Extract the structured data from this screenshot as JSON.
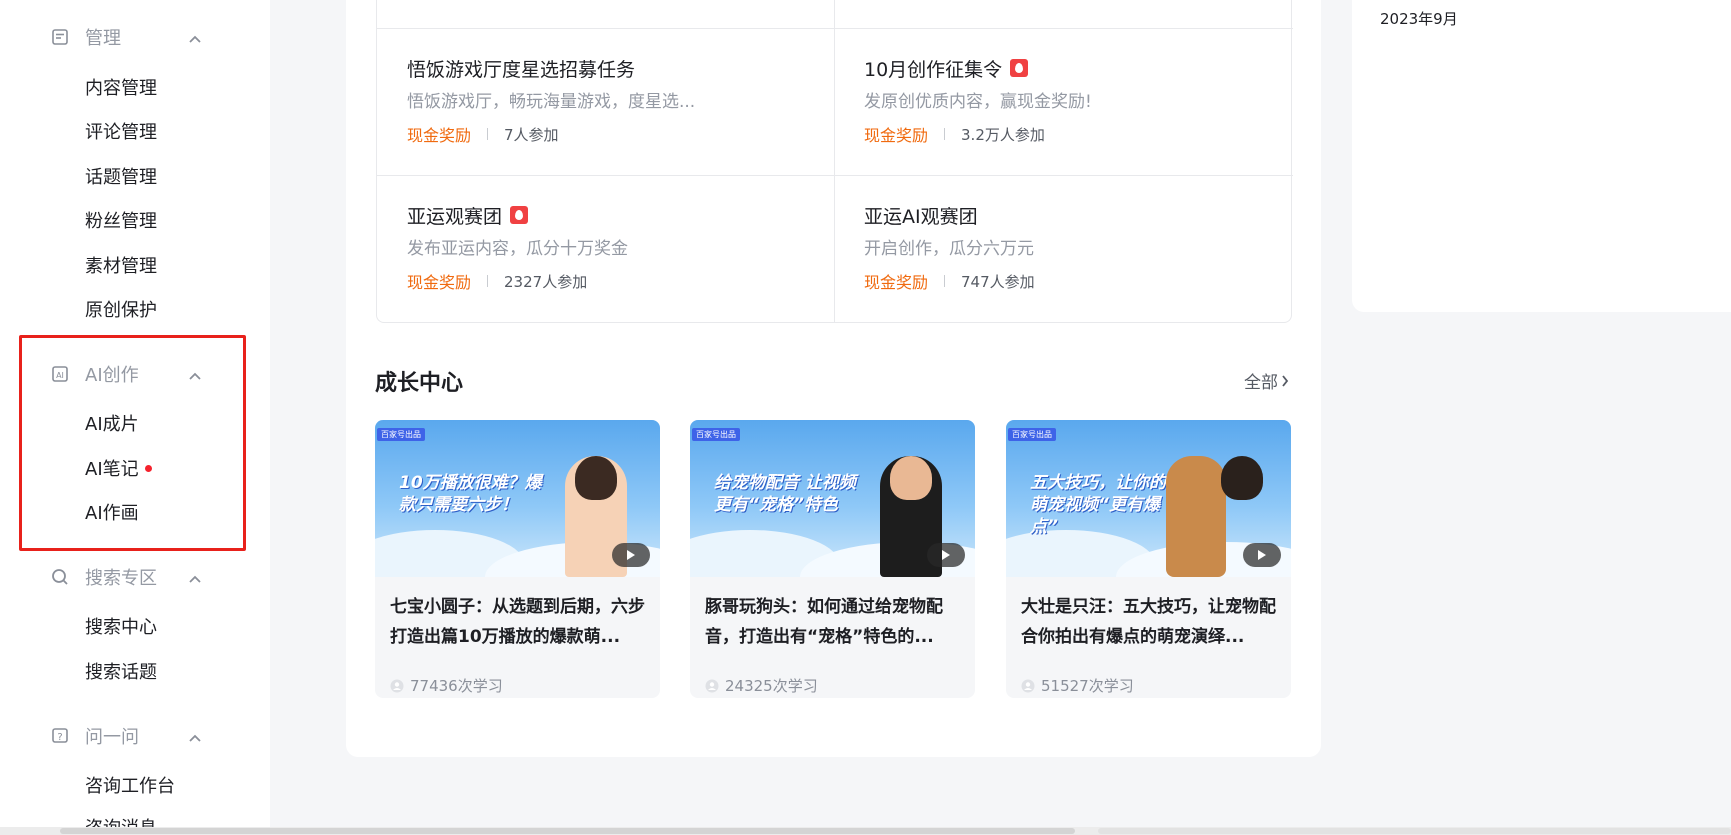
{
  "sidebar": {
    "manage": {
      "title": "管理",
      "items": [
        "内容管理",
        "评论管理",
        "话题管理",
        "粉丝管理",
        "素材管理",
        "原创保护"
      ]
    },
    "ai": {
      "title": "AI创作",
      "items": [
        "AI成片",
        "AI笔记",
        "AI作画"
      ]
    },
    "search": {
      "title": "搜索专区",
      "items": [
        "搜索中心",
        "搜索话题"
      ]
    },
    "ask": {
      "title": "问一问",
      "items": [
        "咨询工作台",
        "咨询消息"
      ]
    }
  },
  "tasks": [
    {
      "title": "悟饭游戏厅度星选招募任务",
      "desc": "悟饭游戏厅，畅玩海量游戏，度星选...",
      "reward": "现金奖励",
      "joined": "7人参加",
      "hot": false
    },
    {
      "title": "10月创作征集令",
      "desc": "发原创优质内容，赢现金奖励!",
      "reward": "现金奖励",
      "joined": "3.2万人参加",
      "hot": true
    },
    {
      "title": "亚运观赛团",
      "desc": "发布亚运内容，瓜分十万奖金",
      "reward": "现金奖励",
      "joined": "2327人参加",
      "hot": true
    },
    {
      "title": "亚运AI观赛团",
      "desc": "开启创作，瓜分六万元",
      "reward": "现金奖励",
      "joined": "747人参加",
      "hot": false
    }
  ],
  "growth": {
    "title": "成长中心",
    "all_label": "全部",
    "courses": [
      {
        "title": "七宝小圆子：从选题到后期，六步打造出篇10万播放的爆款萌...",
        "stat": "77436次学习",
        "thumb_badge": "百家号出品",
        "thumb_text": "10万播放很难？爆款只需要六步！"
      },
      {
        "title": "豚哥玩狗头：如何通过给宠物配音，打造出有“宠格”特色的...",
        "stat": "24325次学习",
        "thumb_badge": "百家号出品",
        "thumb_text": "给宠物配音 让视频更有“宠格”特色"
      },
      {
        "title": "大壮是只汪：五大技巧，让宠物配合你拍出有爆点的萌宠演绎...",
        "stat": "51527次学习",
        "thumb_badge": "百家号出品",
        "thumb_text": "五大技巧，让你的萌宠视频“更有爆点”"
      }
    ]
  },
  "right": {
    "date": "2023年9月"
  },
  "colors": {
    "accent_reward": "#f06a0f",
    "highlight_box": "#e8211b",
    "hot_badge": "#f04142"
  }
}
